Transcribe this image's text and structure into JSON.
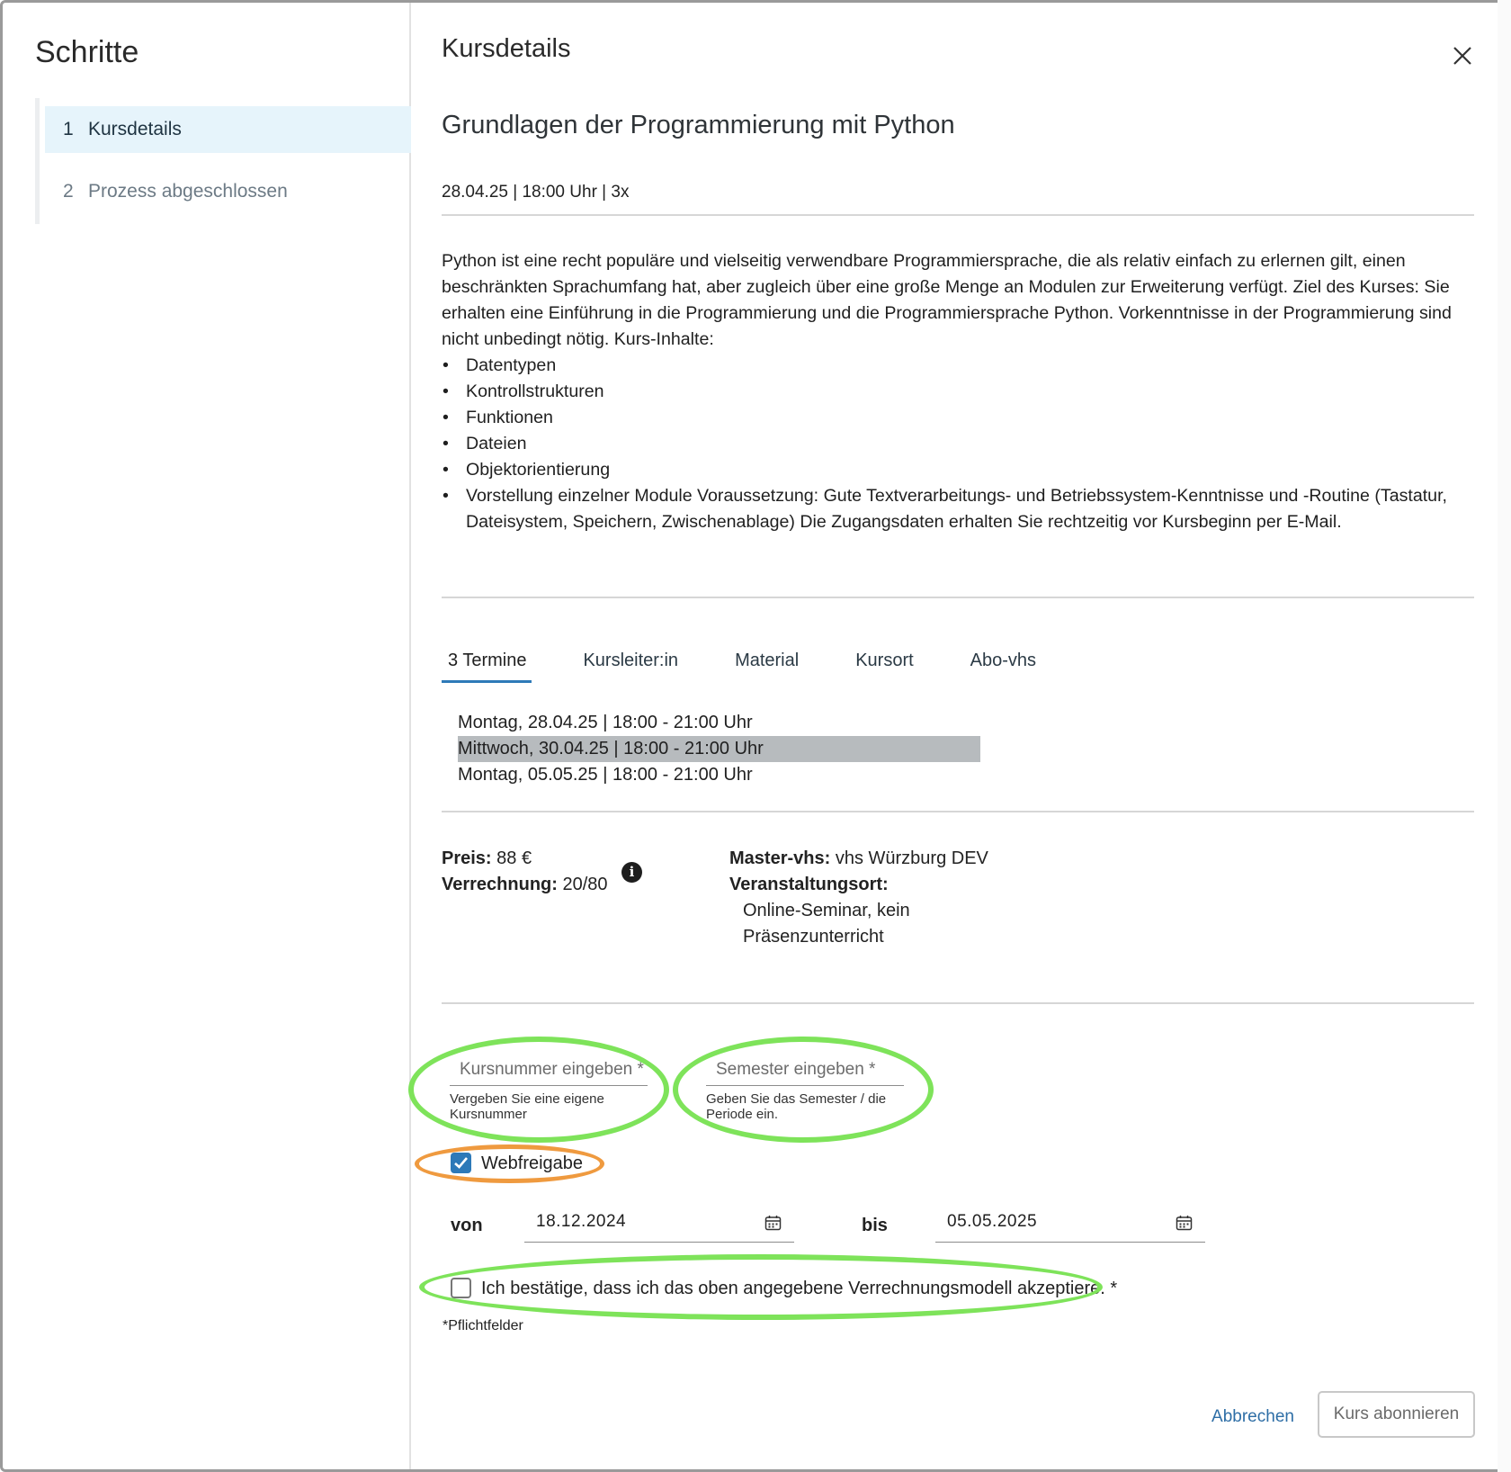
{
  "steps": {
    "title": "Schritte",
    "items": [
      {
        "num": "1",
        "label": "Kursdetails"
      },
      {
        "num": "2",
        "label": "Prozess abgeschlossen"
      }
    ]
  },
  "main": {
    "title": "Kursdetails",
    "course_title": "Grundlagen der Programmierung mit Python",
    "course_meta": "28.04.25 | 18:00 Uhr | 3x",
    "description_intro": "Python ist eine recht populäre und vielseitig verwendbare Programmiersprache, die als relativ einfach zu erlernen gilt, einen beschränkten Sprachumfang hat, aber zugleich über eine große Menge an Modulen zur Erweiterung verfügt. Ziel des Kurses: Sie erhalten eine Einführung in die Programmierung und die Programmiersprache Python. Vorkenntnisse in der Programmierung sind nicht unbedingt nötig. Kurs-Inhalte:",
    "description_bullets": [
      "Datentypen",
      "Kontrollstrukturen",
      "Funktionen",
      "Dateien",
      "Objektorientierung"
    ],
    "description_last_bullet": "Vorstellung einzelner Module Voraussetzung: Gute Textverarbeitungs- und Betriebssystem-Kenntnisse und -Routine (Tastatur, Dateisystem, Speichern, Zwischenablage) Die Zugangsdaten erhalten Sie rechtzeitig vor Kursbeginn per E-Mail.",
    "tabs": [
      "3 Termine",
      "Kursleiter:in",
      "Material",
      "Kursort",
      "Abo-vhs"
    ],
    "dates": [
      "Montag, 28.04.25 | 18:00 - 21:00 Uhr",
      "Mittwoch, 30.04.25 | 18:00 - 21:00 Uhr",
      "Montag, 05.05.25 | 18:00 - 21:00 Uhr"
    ],
    "highlighted_date_index": 1,
    "price_label": "Preis:",
    "price_value": "88 €",
    "billing_label": "Verrechnung:",
    "billing_value": "20/80",
    "info_icon_glyph": "i",
    "master_label": "Master-vhs:",
    "master_value": "vhs Würzburg DEV",
    "venue_label": "Veranstaltungsort:",
    "venue_line1": "Online-Seminar, kein",
    "venue_line2": "Präsenzunterricht"
  },
  "form": {
    "course_number_placeholder": "Kursnummer eingeben *",
    "course_number_hint": "Vergeben Sie eine eigene Kursnummer",
    "semester_placeholder": "Semester eingeben *",
    "semester_hint": "Geben Sie das Semester / die Periode ein.",
    "web_release_label": "Webfreigabe",
    "web_release_checked": true,
    "from_label": "von",
    "from_value": "18.12.2024",
    "to_label": "bis",
    "to_value": "05.05.2025",
    "confirm_label": "Ich bestätige, dass ich das oben angegebene Verrechnungsmodell akzeptiere. *",
    "confirm_checked": false,
    "required_note": "*Pflichtfelder"
  },
  "actions": {
    "cancel_label": "Abbrechen",
    "submit_label": "Kurs abonnieren"
  },
  "colors": {
    "accent": "#2e7ab8",
    "active_step_bg": "#e6f4fb",
    "highlight_row": "#b7bbbe",
    "annotation_green": "#7ee35a",
    "annotation_orange": "#ef9a3f"
  }
}
